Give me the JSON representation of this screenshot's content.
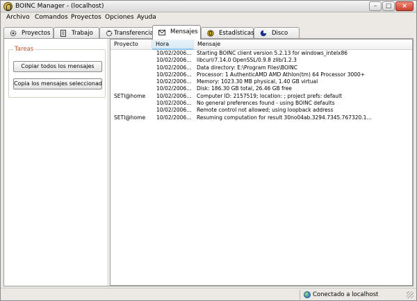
{
  "window": {
    "title": "BOINC Manager - (localhost)"
  },
  "menu": {
    "items": [
      "Archivo",
      "Comandos",
      "Proyectos",
      "Opciones",
      "Ayuda"
    ]
  },
  "tabs": [
    {
      "label": "Proyectos",
      "icon": "gear-icon"
    },
    {
      "label": "Trabajo",
      "icon": "document-icon"
    },
    {
      "label": "Transferencias",
      "icon": "transfer-icon"
    },
    {
      "label": "Mensajes",
      "icon": "envelope-icon",
      "active": true
    },
    {
      "label": "Estadísticas",
      "icon": "stats-icon"
    },
    {
      "label": "Disco",
      "icon": "disk-pie-icon"
    }
  ],
  "tasks": {
    "title": "Tareas",
    "copy_all": "Copiar todos los mensajes",
    "copy_selected": "Copia los mensajes seleccionados"
  },
  "messages": {
    "columns": {
      "project": "Proyecto",
      "time": "Hora",
      "message": "Mensaje"
    },
    "rows": [
      {
        "project": "",
        "time": "10/02/2006...",
        "message": "Starting BOINC client version 5.2.13 for windows_intelx86"
      },
      {
        "project": "",
        "time": "10/02/2006...",
        "message": "libcurl/7.14.0 OpenSSL/0.9.8 zlib/1.2.3"
      },
      {
        "project": "",
        "time": "10/02/2006...",
        "message": "Data directory: E:\\Program Files\\BOINC"
      },
      {
        "project": "",
        "time": "10/02/2006...",
        "message": "Processor: 1 AuthenticAMD AMD Athlon(tm) 64 Processor 3000+"
      },
      {
        "project": "",
        "time": "10/02/2006...",
        "message": "Memory: 1023.30 MB physical, 1.40 GB virtual"
      },
      {
        "project": "",
        "time": "10/02/2006...",
        "message": "Disk: 186.30 GB total, 26.46 GB free"
      },
      {
        "project": "SETI@home",
        "time": "10/02/2006...",
        "message": "Computer ID: 2157519; location: ; project prefs: default"
      },
      {
        "project": "",
        "time": "10/02/2006...",
        "message": "No general preferences found - using BOINC defaults"
      },
      {
        "project": "",
        "time": "10/02/2006...",
        "message": "Remote control not allowed; using loopback address"
      },
      {
        "project": "SETI@home",
        "time": "10/02/2006...",
        "message": "Resuming computation for result 30no04ab.3294.7345.767320.1..."
      }
    ]
  },
  "status": {
    "connection": "Conectado a localhost"
  },
  "colors": {
    "task_title": "#c0502a",
    "sorted_column": "#d5e9f6"
  }
}
